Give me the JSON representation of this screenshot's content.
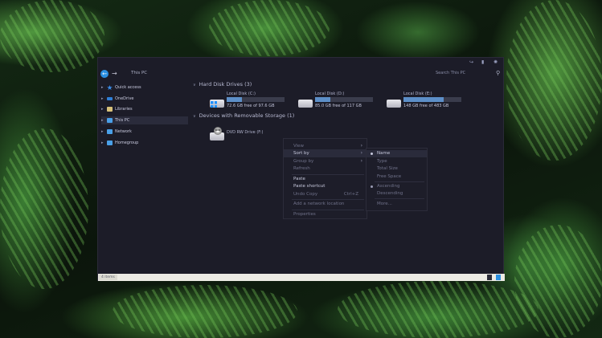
{
  "window": {
    "address": "This PC",
    "search_placeholder": "Search This PC"
  },
  "sidebar": {
    "items": [
      {
        "label": "Quick access",
        "icon": "star-icon"
      },
      {
        "label": "OneDrive",
        "icon": "cloud-icon"
      },
      {
        "label": "Libraries",
        "icon": "library-icon"
      },
      {
        "label": "This PC",
        "icon": "computer-icon",
        "selected": true
      },
      {
        "label": "Network",
        "icon": "network-icon"
      },
      {
        "label": "Homegroup",
        "icon": "homegroup-icon"
      }
    ]
  },
  "main": {
    "hdd_group": "Hard Disk Drives (3)",
    "removable_group": "Devices with Removable Storage (1)",
    "drives": [
      {
        "name": "Local Disk (C:)",
        "free": "72.6 GB free of 97.6 GB",
        "used_fraction": 0.26
      },
      {
        "name": "Local Disk (D:)",
        "free": "85.0 GB free of 117 GB",
        "used_fraction": 0.27
      },
      {
        "name": "Local Disk (E:)",
        "free": "148 GB free of 483 GB",
        "used_fraction": 0.69
      }
    ],
    "dvd": {
      "name": "DVD RW Drive (F:)",
      "badge": "DVD"
    }
  },
  "status": {
    "item_count": "4 items"
  },
  "context_menu": {
    "view": "View",
    "sort_by": "Sort by",
    "group_by": "Group by",
    "refresh": "Refresh",
    "paste": "Paste",
    "paste_shortcut": "Paste shortcut",
    "undo_copy": "Undo Copy",
    "undo_shortcut": "Ctrl+Z",
    "add_network_location": "Add a network location",
    "properties": "Properties"
  },
  "sort_submenu": {
    "name": "Name",
    "type": "Type",
    "total_size": "Total Size",
    "free_space": "Free Space",
    "ascending": "Ascending",
    "descending": "Descending",
    "more": "More..."
  },
  "colors": {
    "window_bg": "#1c1c28",
    "accent": "#2b8fe0",
    "drive_bar": "#5d8fc8"
  }
}
